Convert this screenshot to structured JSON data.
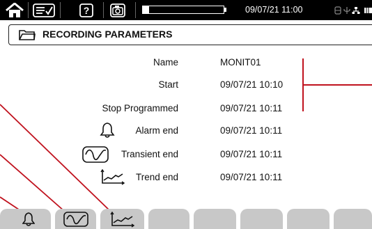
{
  "status_bar": {
    "datetime": "09/07/21 11:00",
    "battery_level": 0.08,
    "icons": [
      "home-icon",
      "checklist-icon",
      "help-icon",
      "screenshot-icon",
      "usb-icon",
      "network-icon",
      "power-icon"
    ]
  },
  "header": {
    "title": "RECORDING PARAMETERS",
    "icon": "folder-icon"
  },
  "rows": [
    {
      "label": "Name",
      "value": "MONIT01"
    },
    {
      "label": "Start",
      "value": "09/07/21 10:10"
    },
    {
      "label": "Stop Programmed",
      "value": "09/07/21 10:11"
    },
    {
      "label": "Alarm end",
      "value": "09/07/21 10:11",
      "icon": "bell-icon"
    },
    {
      "label": "Transient end",
      "value": "09/07/21 10:11",
      "icon": "transient-icon"
    },
    {
      "label": "Trend end",
      "value": "09/07/21 10:11",
      "icon": "trend-icon"
    }
  ],
  "bottom_tabs": [
    {
      "name": "tab-alarm",
      "icon": "bell-icon"
    },
    {
      "name": "tab-transient",
      "icon": "transient-icon"
    },
    {
      "name": "tab-trend",
      "icon": "trend-icon"
    },
    {
      "name": "tab-empty-4"
    },
    {
      "name": "tab-empty-5"
    },
    {
      "name": "tab-empty-6"
    },
    {
      "name": "tab-empty-7"
    },
    {
      "name": "tab-empty-8"
    }
  ],
  "colors": {
    "annotation_line": "#c0121e",
    "topbar": "#000000",
    "tab": "#c8c8c8"
  }
}
